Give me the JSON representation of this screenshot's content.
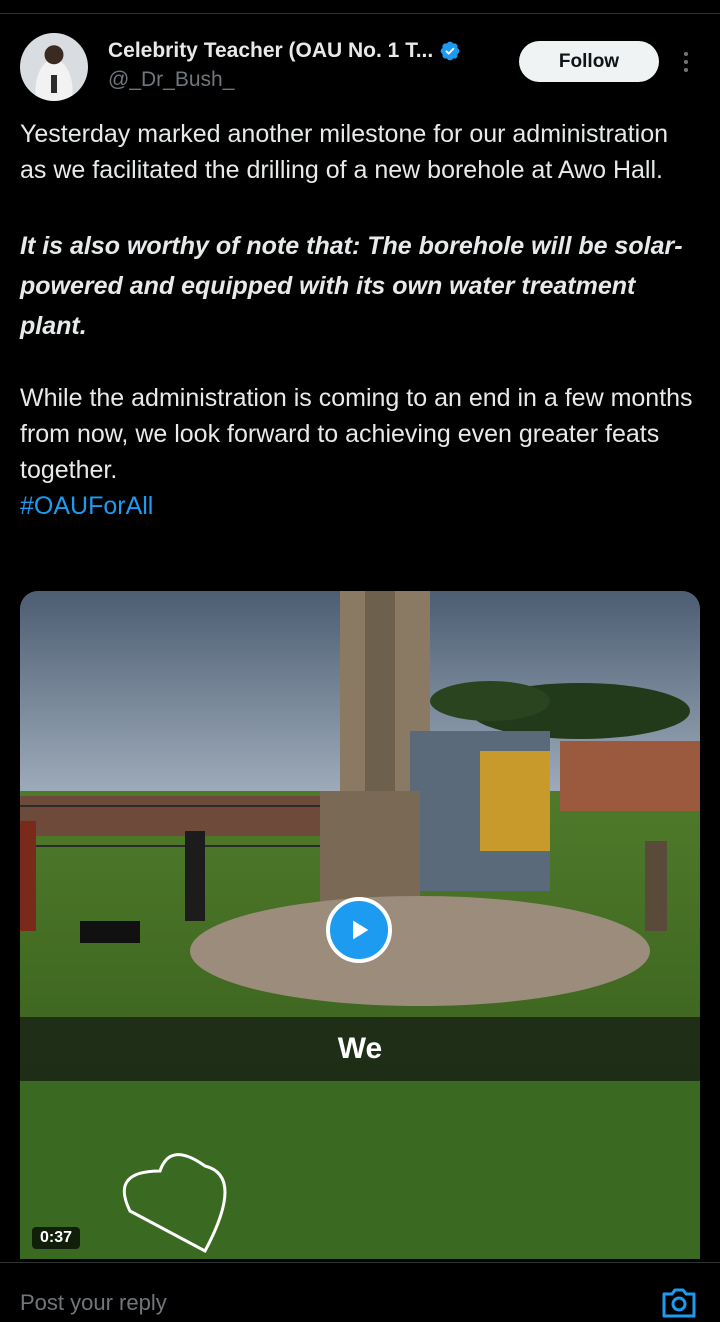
{
  "author": {
    "display_name": "Celebrity Teacher (OAU No. 1 T...",
    "handle": "@_Dr_Bush_"
  },
  "header": {
    "follow_label": "Follow"
  },
  "tweet": {
    "paragraph1": "Yesterday marked another milestone for our administration as we facilitated the drilling of a new borehole at Awo Hall.",
    "paragraph2": "It is also worthy of note that: The borehole will be solar-powered and equipped with its own water treatment plant.",
    "paragraph3": "While the administration is coming to an end in a few months from now, we look forward to achieving even greater feats together.",
    "hashtag": "#OAUForAll"
  },
  "media": {
    "caption": "We",
    "duration": "0:37"
  },
  "reply": {
    "placeholder": "Post your reply"
  },
  "colors": {
    "background": "#000000",
    "text": "#e7e9ea",
    "secondary_text": "#71767b",
    "accent": "#1d9bf0",
    "follow_button_bg": "#eff3f4"
  },
  "icons": [
    "verified-badge-icon",
    "more-options-icon",
    "play-icon",
    "camera-icon"
  ]
}
